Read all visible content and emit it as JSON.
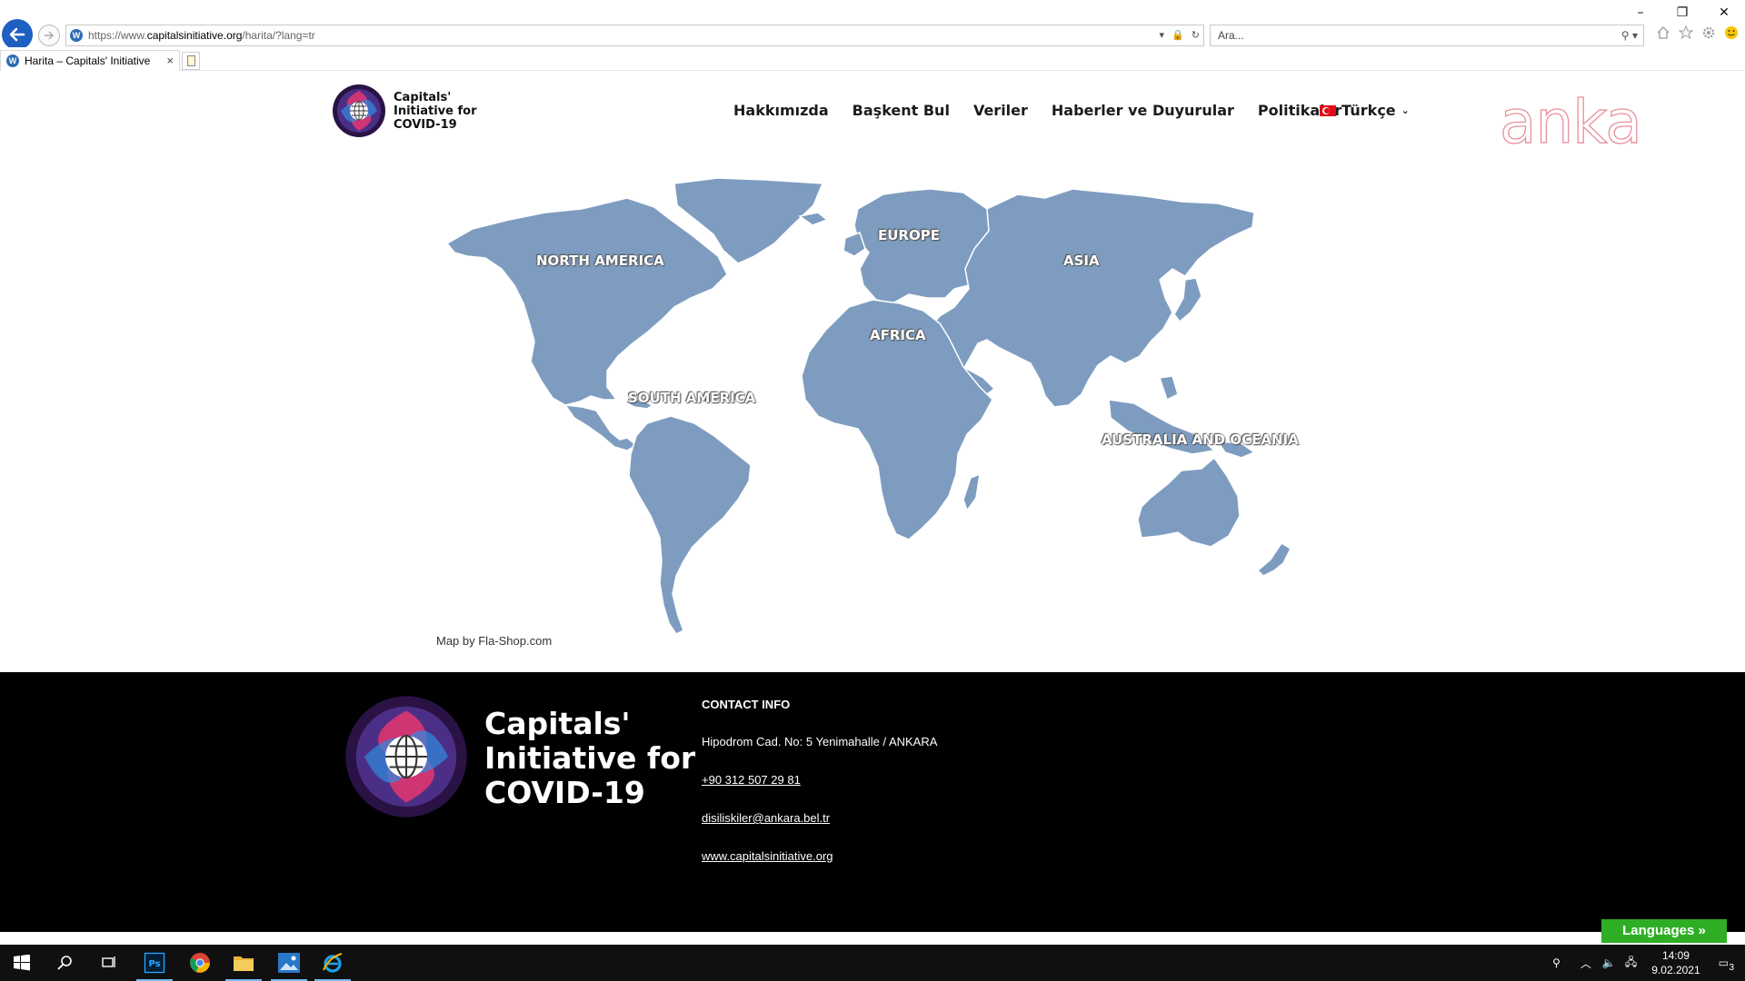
{
  "browser": {
    "url_prefix": "https://www.",
    "url_domain": "capitalsinitiative.org",
    "url_path": "/harita/?lang=tr",
    "search_placeholder": "Ara...",
    "tab_title": "Harita – Capitals' Initiative"
  },
  "header": {
    "logo_text": "Capitals'\nInitiative for\nCOVID-19",
    "nav": [
      "Hakkımızda",
      "Başkent Bul",
      "Veriler",
      "Haberler ve Duyurular",
      "Politikalar"
    ],
    "language": "Türkçe",
    "partner_logo_text": "anka"
  },
  "map": {
    "labels": {
      "north_america": "NORTH AMERICA",
      "south_america": "SOUTH AMERICA",
      "europe": "EUROPE",
      "africa": "AFRICA",
      "asia": "ASIA",
      "oceania": "AUSTRALIA AND OCEANIA"
    },
    "credit": "Map by Fla-Shop.com",
    "fill_color": "#7d9cc0"
  },
  "footer": {
    "logo_text": "Capitals'\nInitiative for\nCOVID-19",
    "contact_title": "CONTACT INFO",
    "address": "Hipodrom Cad. No: 5 Yenimahalle / ANKARA",
    "phone": "+90 312 507 29 81",
    "email": "disiliskiler@ankara.bel.tr",
    "website": "www.capitalsinitiative.org"
  },
  "languages_button": "Languages »",
  "taskbar": {
    "time": "14:09",
    "date": "9.02.2021",
    "notifications": "3",
    "apps": [
      "start-icon",
      "search-icon",
      "task-view-icon",
      "photoshop-icon",
      "chrome-icon",
      "file-explorer-icon",
      "photos-icon",
      "internet-explorer-icon"
    ]
  }
}
